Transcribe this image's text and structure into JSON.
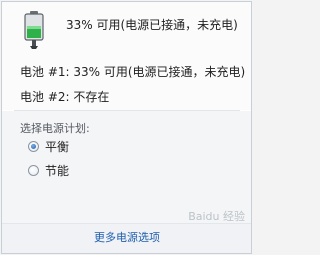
{
  "battery_summary": {
    "icon": "battery-charging-icon",
    "text": "33% 可用(电源已接通，未充电)"
  },
  "batteries": [
    {
      "label": "电池 #1: 33% 可用(电源已接通，未充电)"
    },
    {
      "label": "电池 #2: 不存在"
    }
  ],
  "power_plan": {
    "title": "选择电源计划:",
    "options": [
      {
        "label": "平衡",
        "selected": true
      },
      {
        "label": "节能",
        "selected": false
      }
    ]
  },
  "footer": {
    "more_options": "更多电源选项"
  },
  "watermark": {
    "text": "Baidu 经验"
  },
  "colors": {
    "battery_green": "#2fb14a",
    "link_blue": "#1f5fae"
  }
}
